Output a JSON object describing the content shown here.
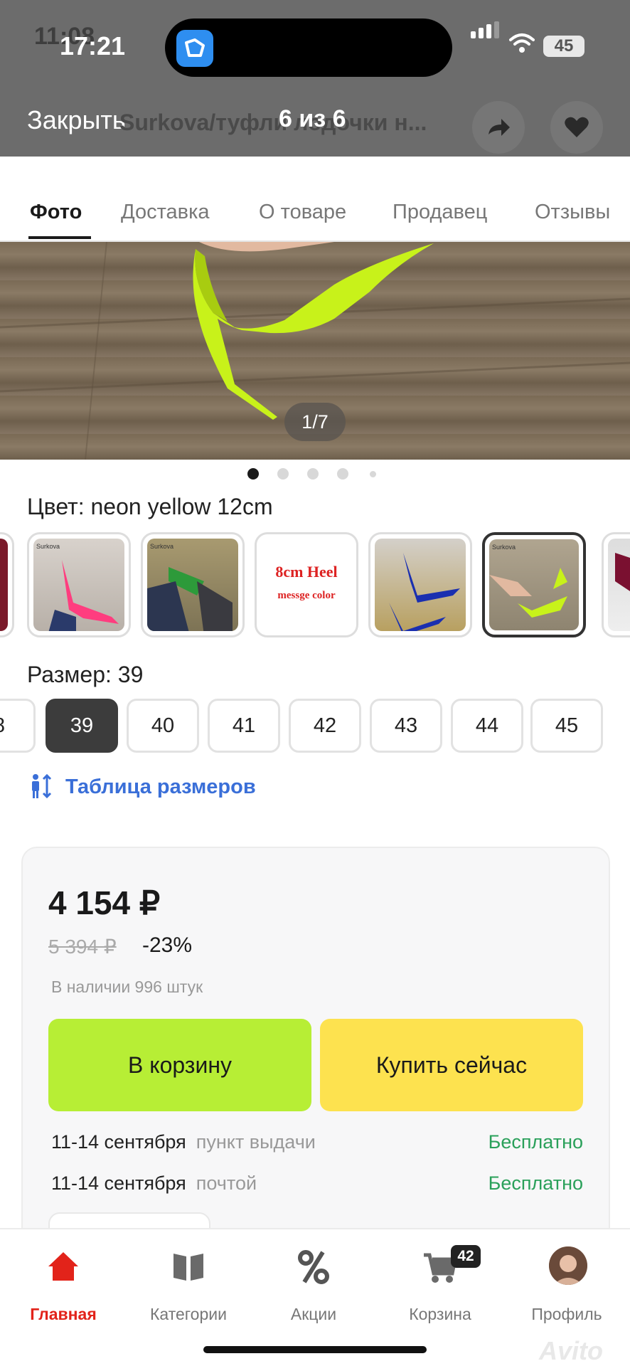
{
  "status_bar": {
    "ghost_time": "11:08",
    "time": "17:21",
    "battery": "45"
  },
  "viewer": {
    "close_label": "Закрыть",
    "ghost_title": "Surkova/туфли лодочки н...",
    "counter": "6 из 6"
  },
  "tabs": [
    {
      "label": "Фото",
      "active": true
    },
    {
      "label": "Доставка",
      "active": false
    },
    {
      "label": "О товаре",
      "active": false
    },
    {
      "label": "Продавец",
      "active": false
    },
    {
      "label": "Отзывы",
      "active": false
    }
  ],
  "photo": {
    "counter": "1/7",
    "shoe_color": "#c8f21a"
  },
  "color": {
    "label": "Цвет: neon yellow 12cm",
    "swatch_brand": "Surkova",
    "swatch_heel_line1": "8cm Heel",
    "swatch_heel_line2": "messge color"
  },
  "size": {
    "label": "Размер: 39",
    "options": [
      "8",
      "39",
      "40",
      "41",
      "42",
      "43",
      "44",
      "45"
    ],
    "selected": "39",
    "table_link": "Таблица размеров"
  },
  "offer": {
    "price": "4 154 ₽",
    "old_price": "5 394 ₽",
    "discount": "-23%",
    "stock": "В наличии 996 штук",
    "cart_button": "В корзину",
    "buy_button": "Купить сейчас",
    "delivery": [
      {
        "date": "11-14 сентября",
        "method": "пункт выдачи",
        "price": "Бесплатно"
      },
      {
        "date": "11-14 сентября",
        "method": "почтой",
        "price": "Бесплатно"
      }
    ]
  },
  "bottom_nav": {
    "home": "Главная",
    "categories": "Категории",
    "promos": "Акции",
    "cart": "Корзина",
    "cart_count": "42",
    "profile": "Профиль",
    "watermark": "Avito"
  },
  "colors": {
    "accent_red": "#e2231a",
    "cart_green": "#b7ee35",
    "buy_yellow": "#fde24f",
    "free_green": "#2aa05a",
    "link_blue": "#3a6fd8"
  }
}
